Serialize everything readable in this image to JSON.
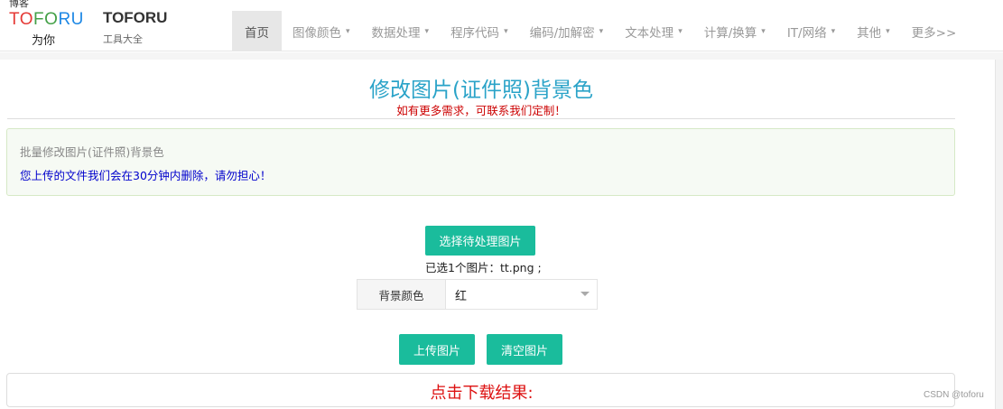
{
  "brand": {
    "logo_top": "博客",
    "logo_letters": [
      "TO",
      "FO",
      "RU"
    ],
    "logo_sub": "为你",
    "title": "TOFORU",
    "subtitle": "工具大全",
    "colors": {
      "red": "#e53935",
      "green": "#43a047",
      "blue": "#1e88e5"
    }
  },
  "nav": {
    "items": [
      {
        "label": "首页",
        "dropdown": false,
        "active": true
      },
      {
        "label": "图像颜色",
        "dropdown": true
      },
      {
        "label": "数据处理",
        "dropdown": true
      },
      {
        "label": "程序代码",
        "dropdown": true
      },
      {
        "label": "编码/加解密",
        "dropdown": true
      },
      {
        "label": "文本处理",
        "dropdown": true
      },
      {
        "label": "计算/换算",
        "dropdown": true
      },
      {
        "label": "IT/网络",
        "dropdown": true
      },
      {
        "label": "其他",
        "dropdown": true
      },
      {
        "label": "更多>>",
        "dropdown": false
      }
    ],
    "caret": "▾"
  },
  "page": {
    "title": "修改图片(证件照)背景色",
    "subtitle": "如有更多需求，可联系我们定制！",
    "title_color": "#2aa3c8"
  },
  "panel": {
    "heading": "批量修改图片(证件照)背景色",
    "note": "您上传的文件我们会在30分钟内删除，请勿担心！"
  },
  "upload": {
    "choose_label": "选择待处理图片",
    "selected_info": "已选1个图片：tt.png ;",
    "bg_label": "背景颜色",
    "bg_value": "红",
    "upload_label": "上传图片",
    "clear_label": "清空图片",
    "accent_color": "#1abc9c"
  },
  "result": {
    "label": "点击下载结果:"
  },
  "watermark": "CSDN @toforu"
}
